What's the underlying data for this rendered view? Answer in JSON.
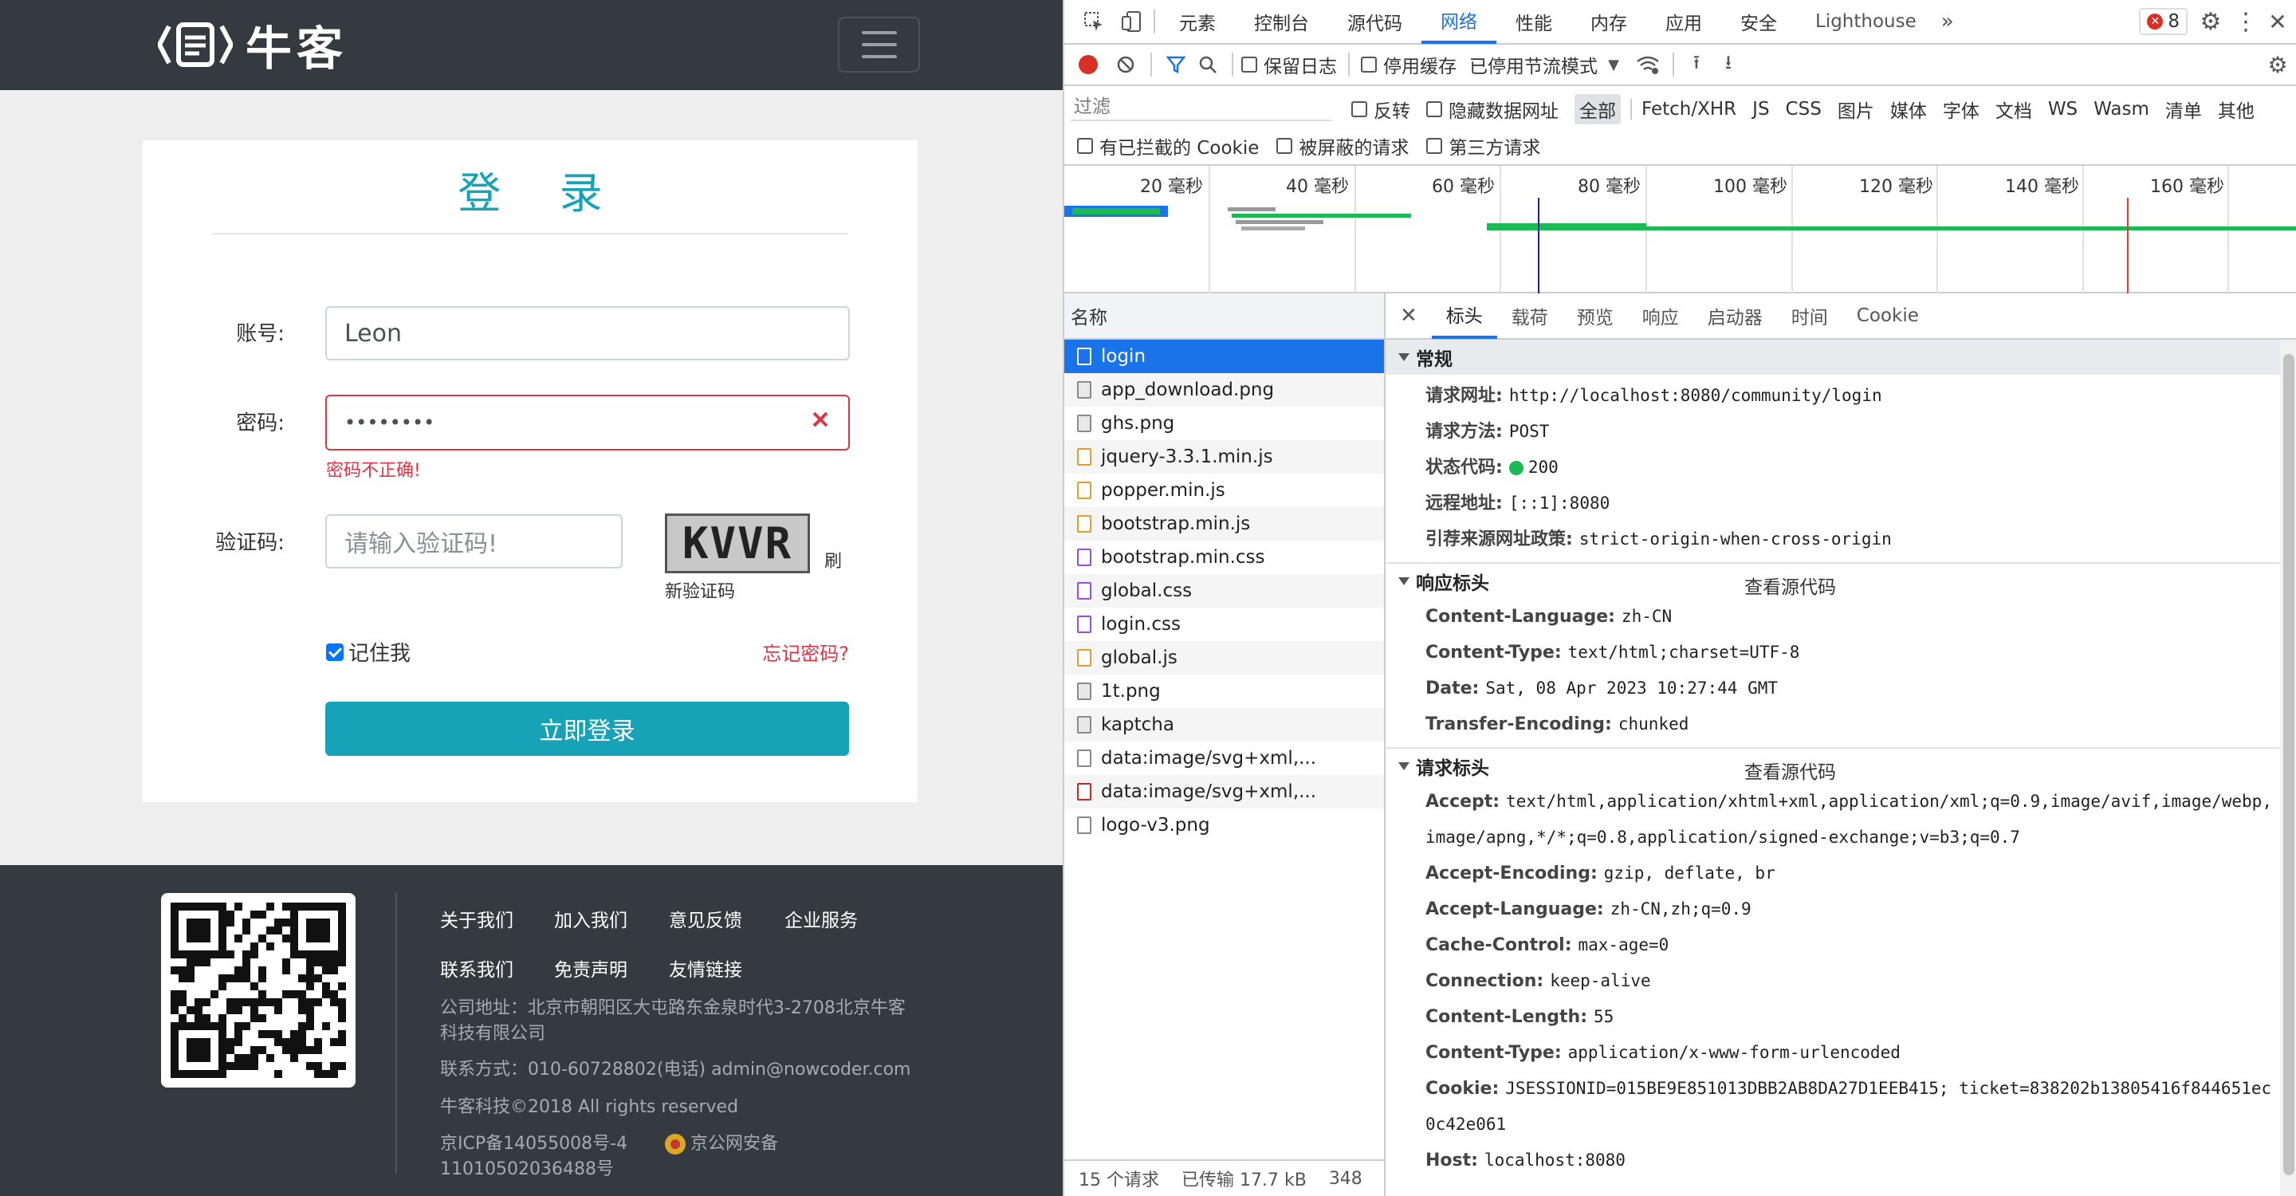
{
  "site": {
    "logo_text": "牛客",
    "login": {
      "title": "登 录",
      "account_label": "账号:",
      "account_value": "Leon",
      "password_label": "密码:",
      "password_value": "••••••••",
      "password_error": "密码不正确!",
      "captcha_label": "验证码:",
      "captcha_placeholder": "请输入验证码!",
      "captcha_text": "KVVR",
      "refresh_label": "刷",
      "new_captcha_label": "新验证码",
      "remember_label": "记住我",
      "forgot_label": "忘记密码?",
      "submit_label": "立即登录"
    },
    "footer": {
      "links_row1": [
        "关于我们",
        "加入我们",
        "意见反馈",
        "企业服务"
      ],
      "links_row2": [
        "联系我们",
        "免责声明",
        "友情链接"
      ],
      "address": "公司地址：北京市朝阳区大屯路东金泉时代3-2708北京牛客科技有限公司",
      "contact": "联系方式：010-60728802(电话)    admin@nowcoder.com",
      "copyright": "牛客科技©2018 All rights reserved",
      "icp": "京ICP备14055008号-4",
      "police": "京公网安备 11010502036488号"
    }
  },
  "devtools": {
    "tabs": [
      "元素",
      "控制台",
      "源代码",
      "网络",
      "性能",
      "内存",
      "应用",
      "安全",
      "Lighthouse"
    ],
    "active_tab": "网络",
    "error_badge": "8",
    "toolbar": {
      "preserve_log": "保留日志",
      "disable_cache": "停用缓存",
      "throttling": "已停用节流模式"
    },
    "filter": {
      "placeholder": "过滤",
      "invert": "反转",
      "hide_data_urls": "隐藏数据网址",
      "types": [
        "全部",
        "Fetch/XHR",
        "JS",
        "CSS",
        "图片",
        "媒体",
        "字体",
        "文档",
        "WS",
        "Wasm",
        "清单",
        "其他"
      ],
      "blocked_cookies": "有已拦截的 Cookie",
      "blocked_requests": "被屏蔽的请求",
      "third_party": "第三方请求"
    },
    "timeline_ticks": [
      "20 毫秒",
      "40 毫秒",
      "60 毫秒",
      "80 毫秒",
      "100 毫秒",
      "120 毫秒",
      "140 毫秒",
      "160 毫秒"
    ],
    "list_header": "名称",
    "requests": [
      {
        "name": "login",
        "type": "doc"
      },
      {
        "name": "app_download.png",
        "type": "img"
      },
      {
        "name": "ghs.png",
        "type": "img"
      },
      {
        "name": "jquery-3.3.1.min.js",
        "type": "js"
      },
      {
        "name": "popper.min.js",
        "type": "js"
      },
      {
        "name": "bootstrap.min.js",
        "type": "js"
      },
      {
        "name": "bootstrap.min.css",
        "type": "css"
      },
      {
        "name": "global.css",
        "type": "css"
      },
      {
        "name": "login.css",
        "type": "css"
      },
      {
        "name": "global.js",
        "type": "js"
      },
      {
        "name": "1t.png",
        "type": "img"
      },
      {
        "name": "kaptcha",
        "type": "img"
      },
      {
        "name": "data:image/svg+xml,...",
        "type": "plain"
      },
      {
        "name": "data:image/svg+xml,...",
        "type": "red"
      },
      {
        "name": "logo-v3.png",
        "type": "plain"
      }
    ],
    "status_bar": {
      "count": "15 个请求",
      "transferred": "已传输 17.7 kB",
      "extra": "348"
    },
    "detail_tabs": [
      "标头",
      "载荷",
      "预览",
      "响应",
      "启动器",
      "时间",
      "Cookie"
    ],
    "general": {
      "title": "常规",
      "rows": [
        {
          "k": "请求网址:",
          "v": "http://localhost:8080/community/login"
        },
        {
          "k": "请求方法:",
          "v": "POST"
        },
        {
          "k": "状态代码:",
          "v": "200"
        },
        {
          "k": "远程地址:",
          "v": "[::1]:8080"
        },
        {
          "k": "引荐来源网址政策:",
          "v": "strict-origin-when-cross-origin"
        }
      ]
    },
    "response_headers": {
      "title": "响应标头",
      "view_source": "查看源代码",
      "rows": [
        {
          "k": "Content-Language:",
          "v": "zh-CN"
        },
        {
          "k": "Content-Type:",
          "v": "text/html;charset=UTF-8"
        },
        {
          "k": "Date:",
          "v": "Sat, 08 Apr 2023 10:27:44 GMT"
        },
        {
          "k": "Transfer-Encoding:",
          "v": "chunked"
        }
      ]
    },
    "request_headers": {
      "title": "请求标头",
      "view_source": "查看源代码",
      "rows": [
        {
          "k": "Accept:",
          "v": "text/html,application/xhtml+xml,application/xml;q=0.9,image/avif,image/webp,image/apng,*/*;q=0.8,application/signed-exchange;v=b3;q=0.7"
        },
        {
          "k": "Accept-Encoding:",
          "v": "gzip, deflate, br"
        },
        {
          "k": "Accept-Language:",
          "v": "zh-CN,zh;q=0.9"
        },
        {
          "k": "Cache-Control:",
          "v": "max-age=0"
        },
        {
          "k": "Connection:",
          "v": "keep-alive"
        },
        {
          "k": "Content-Length:",
          "v": "55"
        },
        {
          "k": "Content-Type:",
          "v": "application/x-www-form-urlencoded"
        },
        {
          "k": "Cookie:",
          "v": "JSESSIONID=015BE9E851013DBB2AB8DA27D1EEB415; ticket=838202b13805416f844651ec0c42e061"
        },
        {
          "k": "Host:",
          "v": "localhost:8080"
        }
      ]
    }
  }
}
